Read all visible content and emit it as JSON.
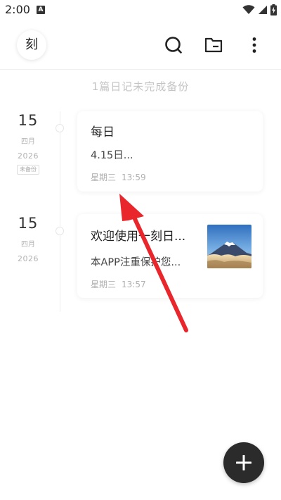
{
  "status_bar": {
    "time": "2:00",
    "notification_icon_letter": "A",
    "icons": [
      "wifi-icon",
      "signal-icon",
      "battery-charging-icon"
    ]
  },
  "header": {
    "app_badge": "刻",
    "actions": [
      "search-icon",
      "folder-icon",
      "more-vert-icon"
    ]
  },
  "backup_notice": "1篇日记未完成备份",
  "entries": [
    {
      "day": "15",
      "month": "四月",
      "year": "2026",
      "backup_tag": "未备份",
      "title": "每日",
      "preview": "4.15日...",
      "weekday": "星期三",
      "time": "13:59",
      "has_thumbnail": false
    },
    {
      "day": "15",
      "month": "四月",
      "year": "2026",
      "backup_tag": "",
      "title": "欢迎使用一刻日...",
      "preview": "本APP注重保护您...",
      "weekday": "星期三",
      "time": "13:57",
      "has_thumbnail": true,
      "thumbnail_subject": "snow-capped mountain above sea of clouds"
    }
  ],
  "fab": {
    "icon": "plus-icon"
  },
  "annotation": {
    "type": "arrow",
    "color": "#e8262b"
  },
  "colors": {
    "fab": "#2b2b2b",
    "annotation_arrow": "#e8262b",
    "muted_text": "#b0b0b0"
  }
}
